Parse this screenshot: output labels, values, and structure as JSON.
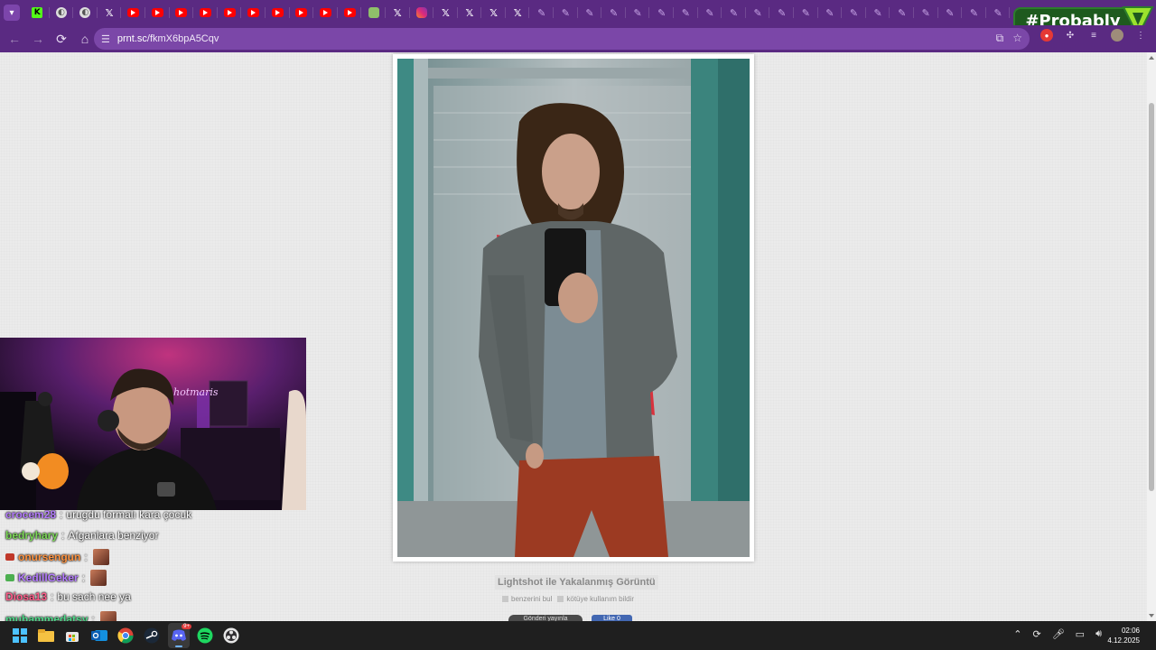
{
  "browser": {
    "url_domain": "prnt.sc",
    "url_path": "/fkmX6bpA5Cqv",
    "tabs": [
      "kick",
      "globe",
      "globe",
      "x",
      "youtube",
      "youtube",
      "youtube",
      "youtube",
      "youtube",
      "youtube",
      "youtube",
      "youtube",
      "youtube",
      "youtube",
      "misc",
      "x",
      "instagram",
      "x",
      "x",
      "x",
      "x",
      "feather",
      "feather",
      "feather",
      "feather",
      "feather",
      "feather",
      "feather",
      "feather",
      "feather",
      "feather",
      "feather",
      "feather",
      "feather",
      "feather",
      "feather",
      "feather",
      "feather",
      "feather",
      "feather",
      "feather"
    ]
  },
  "overlay": {
    "tag": "#Probably",
    "accent": "#1e5a1e",
    "logo_color": "#9be22d"
  },
  "page": {
    "caption": "Lightshot ile Yakalanmış Görüntü",
    "link_similar": "benzerini bul",
    "link_report": "kötüye kullanım bildir",
    "share_x": "Gönderi yayınla",
    "share_fb": "Like 0"
  },
  "webcam": {
    "neon_sign": "hotmaris"
  },
  "chat": {
    "messages": [
      {
        "user": "crocem28",
        "color": "#b57cff",
        "sep": ":",
        "text": "urugdu formalı kara çocuk",
        "badge": ""
      },
      {
        "user": "bedryhary",
        "color": "#7cd957",
        "sep": ":",
        "text": "Afganlara benziyor",
        "badge": ""
      },
      {
        "user": "onursengun",
        "color": "#ff9340",
        "sep": ":",
        "text": "",
        "badge": "#c0392b",
        "emote": true
      },
      {
        "user": "KedillGeker",
        "color": "#b57cff",
        "sep": ":",
        "text": "",
        "badge": "#4caf50",
        "emote": true
      },
      {
        "user": "Diosa13",
        "color": "#ff5c8a",
        "sep": ":",
        "text": "bu sach nee ya",
        "badge": ""
      },
      {
        "user": "muhammedatsy",
        "color": "#4fd98a",
        "sep": ":",
        "text": "",
        "badge": "",
        "emote": true
      }
    ]
  },
  "taskbar": {
    "time": "02:06",
    "date": "4.12.2025",
    "discord_badge": "9+"
  }
}
